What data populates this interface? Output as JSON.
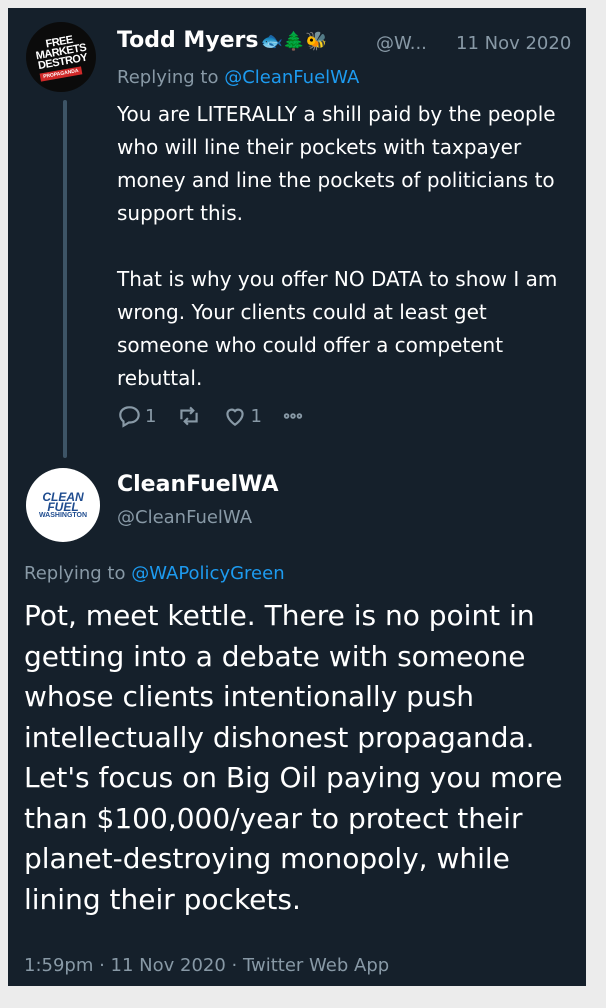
{
  "tweet1": {
    "name": "Todd Myers",
    "emoji": "🐟🌲🐝",
    "handle": "@W...",
    "date": "11 Nov 2020",
    "replying_prefix": "Replying to ",
    "replying_to": "@CleanFuelWA",
    "paragraph1": "You are LITERALLY a shill paid by the people who will line their pockets with taxpayer money and line the pockets of politicians to support this.",
    "paragraph2": "That is why you offer NO DATA to show I am wrong. Your clients could at least get someone who could offer a competent rebuttal.",
    "avatar_text": "FREE MARKETS DESTROY",
    "avatar_stamp": "PROPAGANDA",
    "reply_count": "1",
    "like_count": "1"
  },
  "tweet2": {
    "name": "CleanFuelWA",
    "handle": "@CleanFuelWA",
    "avatar_line1": "CLEAN FUEL",
    "avatar_line2": "WASHINGTON",
    "replying_prefix": "Replying to ",
    "replying_to": "@WAPolicyGreen",
    "body": "Pot, meet kettle. There is no point in getting into a debate with someone whose clients intentionally push intellectually dishonest propaganda. Let's focus on Big Oil paying you more than $100,000/year to protect their planet-destroying monopoly, while lining their pockets.",
    "footer": "1:59pm · 11 Nov 2020 · Twitter Web App"
  },
  "colors": {
    "background": "#15202b",
    "muted": "#8899a6",
    "link": "#1d9bf0"
  },
  "icons": [
    "reply-icon",
    "retweet-icon",
    "like-icon",
    "more-icon"
  ]
}
